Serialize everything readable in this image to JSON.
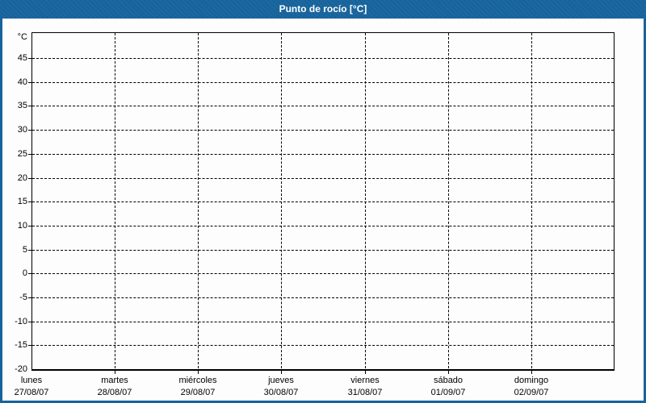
{
  "window": {
    "title": "Punto de rocío [°C]",
    "colors": {
      "titlebar": "#17639c",
      "border": "#17639c",
      "background": "#fdfdfd",
      "grid": "#000000",
      "title_text": "#ffffff",
      "tick_text": "#000000"
    }
  },
  "chart_data": {
    "type": "line",
    "title": "Punto de rocío [°C]",
    "ylabel": "°C",
    "ylim": [
      -20,
      50.4
    ],
    "ytick_interval": 5,
    "yticks": [
      45,
      40,
      35,
      30,
      25,
      20,
      15,
      10,
      5,
      0,
      -5,
      -10,
      -15,
      -20
    ],
    "grid": "dashed",
    "legend": "none",
    "x_categories": [
      {
        "day": "lunes",
        "date": "27/08/07"
      },
      {
        "day": "martes",
        "date": "28/08/07"
      },
      {
        "day": "miércoles",
        "date": "29/08/07"
      },
      {
        "day": "jueves",
        "date": "30/08/07"
      },
      {
        "day": "viernes",
        "date": "31/08/07"
      },
      {
        "day": "sábado",
        "date": "01/09/07"
      },
      {
        "day": "domingo",
        "date": "02/09/07"
      }
    ],
    "series": []
  }
}
